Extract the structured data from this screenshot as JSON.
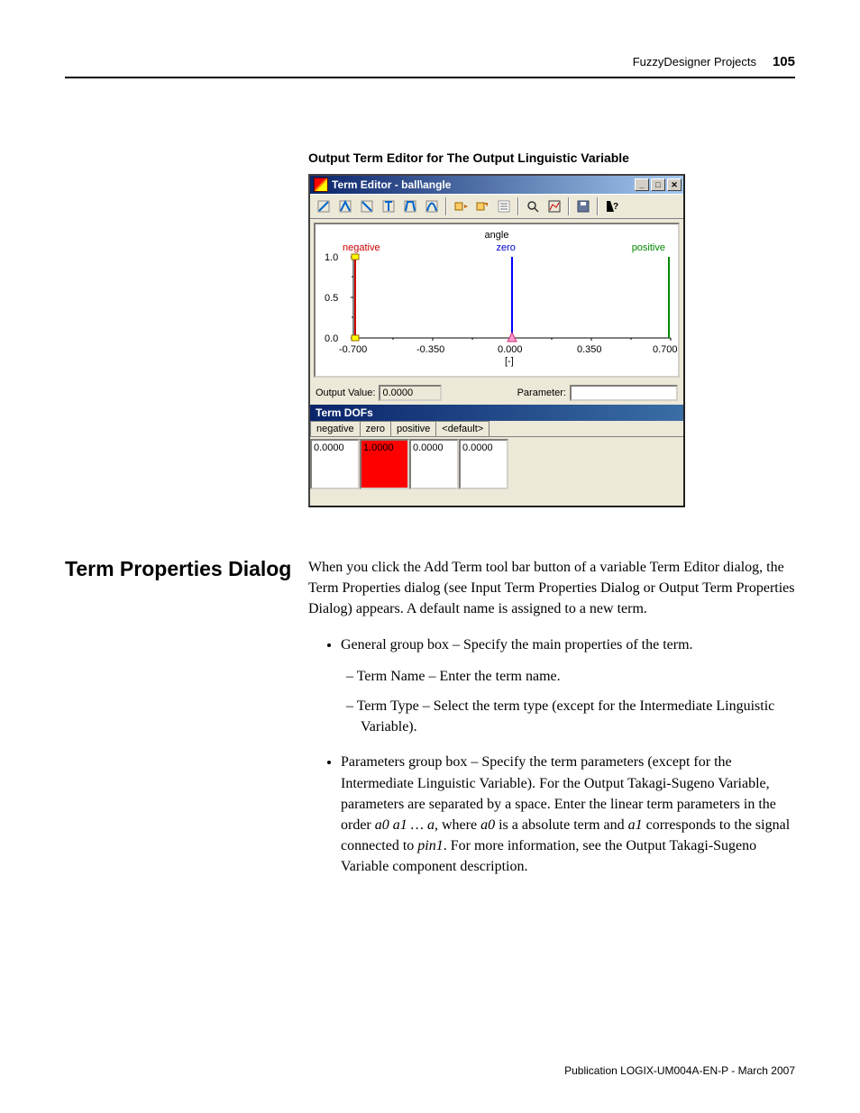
{
  "header": {
    "chapter": "FuzzyDesigner Projects",
    "page_number": "105"
  },
  "figure_caption": "Output Term Editor for The Output Linguistic Variable",
  "window": {
    "title": "Term Editor - ball\\angle",
    "win_buttons": {
      "min": "_",
      "max": "□",
      "close": "✕"
    }
  },
  "plot": {
    "axis_title": "angle",
    "legend": {
      "left": "negative",
      "center": "zero",
      "right": "positive"
    },
    "y_ticks": [
      "1.0",
      "0.5",
      "0.0"
    ],
    "x_ticks": [
      "-0.700",
      "-0.350",
      "0.000",
      "0.350",
      "0.700"
    ],
    "x_unit": "[-]"
  },
  "output_row": {
    "output_label": "Output Value:",
    "output_value": "0.0000",
    "parameter_label": "Parameter:",
    "parameter_value": ""
  },
  "dofs": {
    "header": "Term DOFs",
    "tabs": [
      "negative",
      "zero",
      "positive",
      "<default>"
    ],
    "values": [
      "0.0000",
      "1.0000",
      "0.0000",
      "0.0000"
    ]
  },
  "section": {
    "title": "Term Properties Dialog",
    "intro": "When you click the Add Term tool bar button of a variable Term Editor dialog, the Term Properties dialog (see Input Term Properties Dialog or Output Term Properties Dialog) appears. A default name is assigned to a new term.",
    "bullets": {
      "b1": "General group box – Specify the main properties of the term.",
      "b1_sub1": "Term Name – Enter the term name.",
      "b1_sub2": "Term Type – Select the term type (except for the Intermediate Linguistic Variable).",
      "b2_pre": "Parameters group box – Specify the term parameters (except for the Intermediate Linguistic Variable). For the Output Takagi-Sugeno Variable, parameters are separated by a space. Enter the linear term parameters in the order ",
      "b2_i1": "a0 a1 … a",
      "b2_mid1": ", where ",
      "b2_i2": "a0",
      "b2_mid2": " is a absolute term and ",
      "b2_i3": "a1",
      "b2_mid3": " corresponds to the signal connected to ",
      "b2_i4": "pin1",
      "b2_end": ". For more information, see the Output Takagi-Sugeno Variable component description."
    }
  },
  "footer": "Publication LOGIX-UM004A-EN-P - March 2007",
  "chart_data": {
    "type": "line",
    "title": "angle",
    "xlabel": "[-]",
    "ylabel": "",
    "xlim": [
      -0.7,
      0.7
    ],
    "ylim": [
      0.0,
      1.0
    ],
    "series": [
      {
        "name": "negative",
        "type": "vertical",
        "x": -0.7,
        "y0": 0.0,
        "y1": 1.0
      },
      {
        "name": "zero",
        "type": "vertical",
        "x": 0.0,
        "y0": 0.0,
        "y1": 1.0
      },
      {
        "name": "positive",
        "type": "vertical",
        "x": 0.7,
        "y0": 0.0,
        "y1": 1.0
      }
    ],
    "marker": {
      "x": -0.7,
      "y": 0.0,
      "shape": "square",
      "color": "#ffff00"
    },
    "handle": {
      "x": 0.0,
      "y": 0.0,
      "shape": "triangle",
      "color": "#ff99cc"
    }
  }
}
